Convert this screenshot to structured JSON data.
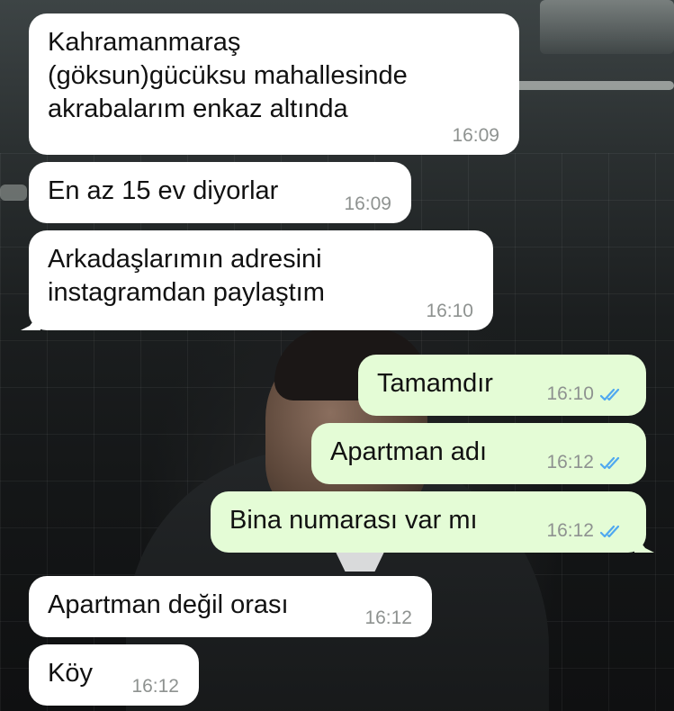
{
  "conversation": {
    "messages": [
      {
        "direction": "incoming",
        "text": "Kahramanmaraş\n(göksun)gücüksu mahallesinde\nakrabalarım enkaz altında",
        "time": "16:09"
      },
      {
        "direction": "incoming",
        "text": "En az 15 ev diyorlar",
        "time": "16:09"
      },
      {
        "direction": "incoming",
        "text": "Arkadaşlarımın adresini\ninstagramdan paylaştım",
        "time": "16:10"
      },
      {
        "direction": "outgoing",
        "text": "Tamamdır",
        "time": "16:10",
        "status": "read"
      },
      {
        "direction": "outgoing",
        "text": "Apartman adı",
        "time": "16:12",
        "status": "read"
      },
      {
        "direction": "outgoing",
        "text": "Bina numarası var mı",
        "time": "16:12",
        "status": "read"
      },
      {
        "direction": "incoming",
        "text": "Apartman değil orası",
        "time": "16:12"
      },
      {
        "direction": "incoming",
        "text": "Köy",
        "time": "16:12"
      }
    ]
  },
  "colors": {
    "incoming_bubble": "#ffffff",
    "outgoing_bubble": "#e4fcd6",
    "timestamp": "#8e9290",
    "read_ticks": "#4fa8f0"
  },
  "icons": {
    "read_receipt": "double-check-icon"
  }
}
